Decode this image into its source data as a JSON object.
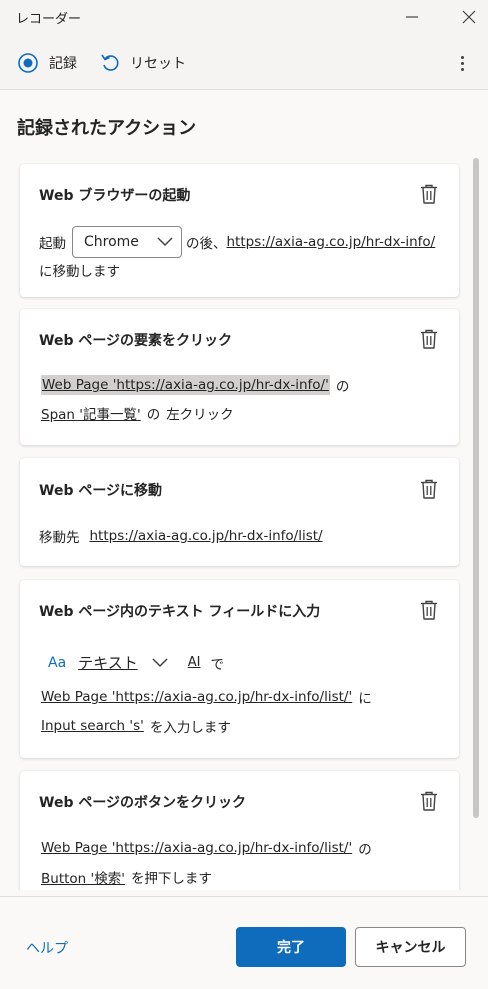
{
  "window": {
    "title": "レコーダー"
  },
  "toolbar": {
    "record_label": "記録",
    "reset_label": "リセット"
  },
  "section_title": "記録されたアクション",
  "cards": [
    {
      "title": "Web ブラウザーの起動",
      "line1_prefix": "起動",
      "browser_select": "Chrome",
      "line1_middle": "の後、",
      "url": "https://axia-ag.co.jp/hr-dx-info/",
      "line2": "に移動します"
    },
    {
      "title": "Web ページの要素をクリック",
      "page_link": "Web Page 'https://axia-ag.co.jp/hr-dx-info/'",
      "particle_no": "の",
      "element_link": "Span '記事一覧'",
      "particle_no2": "の",
      "action": "左クリック"
    },
    {
      "title": "Web ページに移動",
      "dest_label": "移動先",
      "url": "https://axia-ag.co.jp/hr-dx-info/list/"
    },
    {
      "title": "Web ページ内のテキスト フィールドに入力",
      "type_icon_text": "Aa",
      "type_label": "テキスト",
      "ai_label": "AI",
      "particle_de": "で",
      "page_link": "Web Page 'https://axia-ag.co.jp/hr-dx-info/list/'",
      "particle_ni": "に",
      "element_link": "Input search 's'",
      "action": "を入力します"
    },
    {
      "title": "Web ページのボタンをクリック",
      "page_link": "Web Page 'https://axia-ag.co.jp/hr-dx-info/list/'",
      "particle_no": "の",
      "element_link": "Button '検索'",
      "action": "を押下します"
    }
  ],
  "footer": {
    "help_label": "ヘルプ",
    "done_label": "完了",
    "cancel_label": "キャンセル"
  },
  "colors": {
    "accent": "#0f6cbd",
    "background": "#faf9f8",
    "card": "#ffffff"
  },
  "icons": [
    "minimize-icon",
    "close-icon",
    "record-radio-icon",
    "reset-icon",
    "more-icon",
    "trash-icon",
    "chevron-down-icon",
    "text-type-icon"
  ]
}
